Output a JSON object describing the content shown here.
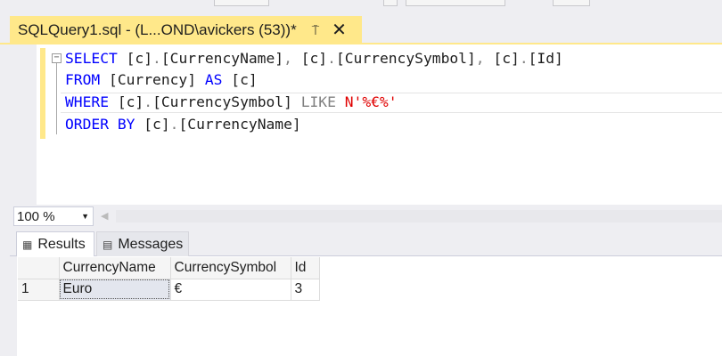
{
  "tab": {
    "title": "SQLQuery1.sql - (L...OND\\avickers (53))*",
    "pin_icon": "pin-icon",
    "close_icon": "close-icon",
    "accent": "#ffe88a"
  },
  "editor": {
    "lines": [
      [
        [
          "kw",
          "SELECT "
        ],
        [
          "t",
          "[c]"
        ],
        [
          "op",
          "."
        ],
        [
          "t",
          "[CurrencyName]"
        ],
        [
          "op",
          ", "
        ],
        [
          "t",
          "[c]"
        ],
        [
          "op",
          "."
        ],
        [
          "t",
          "[CurrencySymbol]"
        ],
        [
          "op",
          ", "
        ],
        [
          "t",
          "[c]"
        ],
        [
          "op",
          "."
        ],
        [
          "t",
          "[Id]"
        ]
      ],
      [
        [
          "kw",
          "FROM "
        ],
        [
          "t",
          "[Currency] "
        ],
        [
          "kw",
          "AS "
        ],
        [
          "t",
          "[c]"
        ]
      ],
      [
        [
          "kw",
          "WHERE "
        ],
        [
          "t",
          "[c]"
        ],
        [
          "op",
          "."
        ],
        [
          "t",
          "[CurrencySymbol] "
        ],
        [
          "op",
          "LIKE "
        ],
        [
          "str",
          "N'%€%'"
        ]
      ],
      [
        [
          "kw",
          "ORDER BY "
        ],
        [
          "t",
          "[c]"
        ],
        [
          "op",
          "."
        ],
        [
          "t",
          "[CurrencyName]"
        ]
      ]
    ]
  },
  "zoom": {
    "value": "100 %"
  },
  "results": {
    "tabs": [
      {
        "label": "Results",
        "icon": "grid-icon"
      },
      {
        "label": "Messages",
        "icon": "messages-icon"
      }
    ],
    "columns": [
      "CurrencyName",
      "CurrencySymbol",
      "Id"
    ],
    "rows": [
      {
        "num": "1",
        "cells": [
          "Euro",
          "€",
          "3"
        ]
      }
    ]
  }
}
